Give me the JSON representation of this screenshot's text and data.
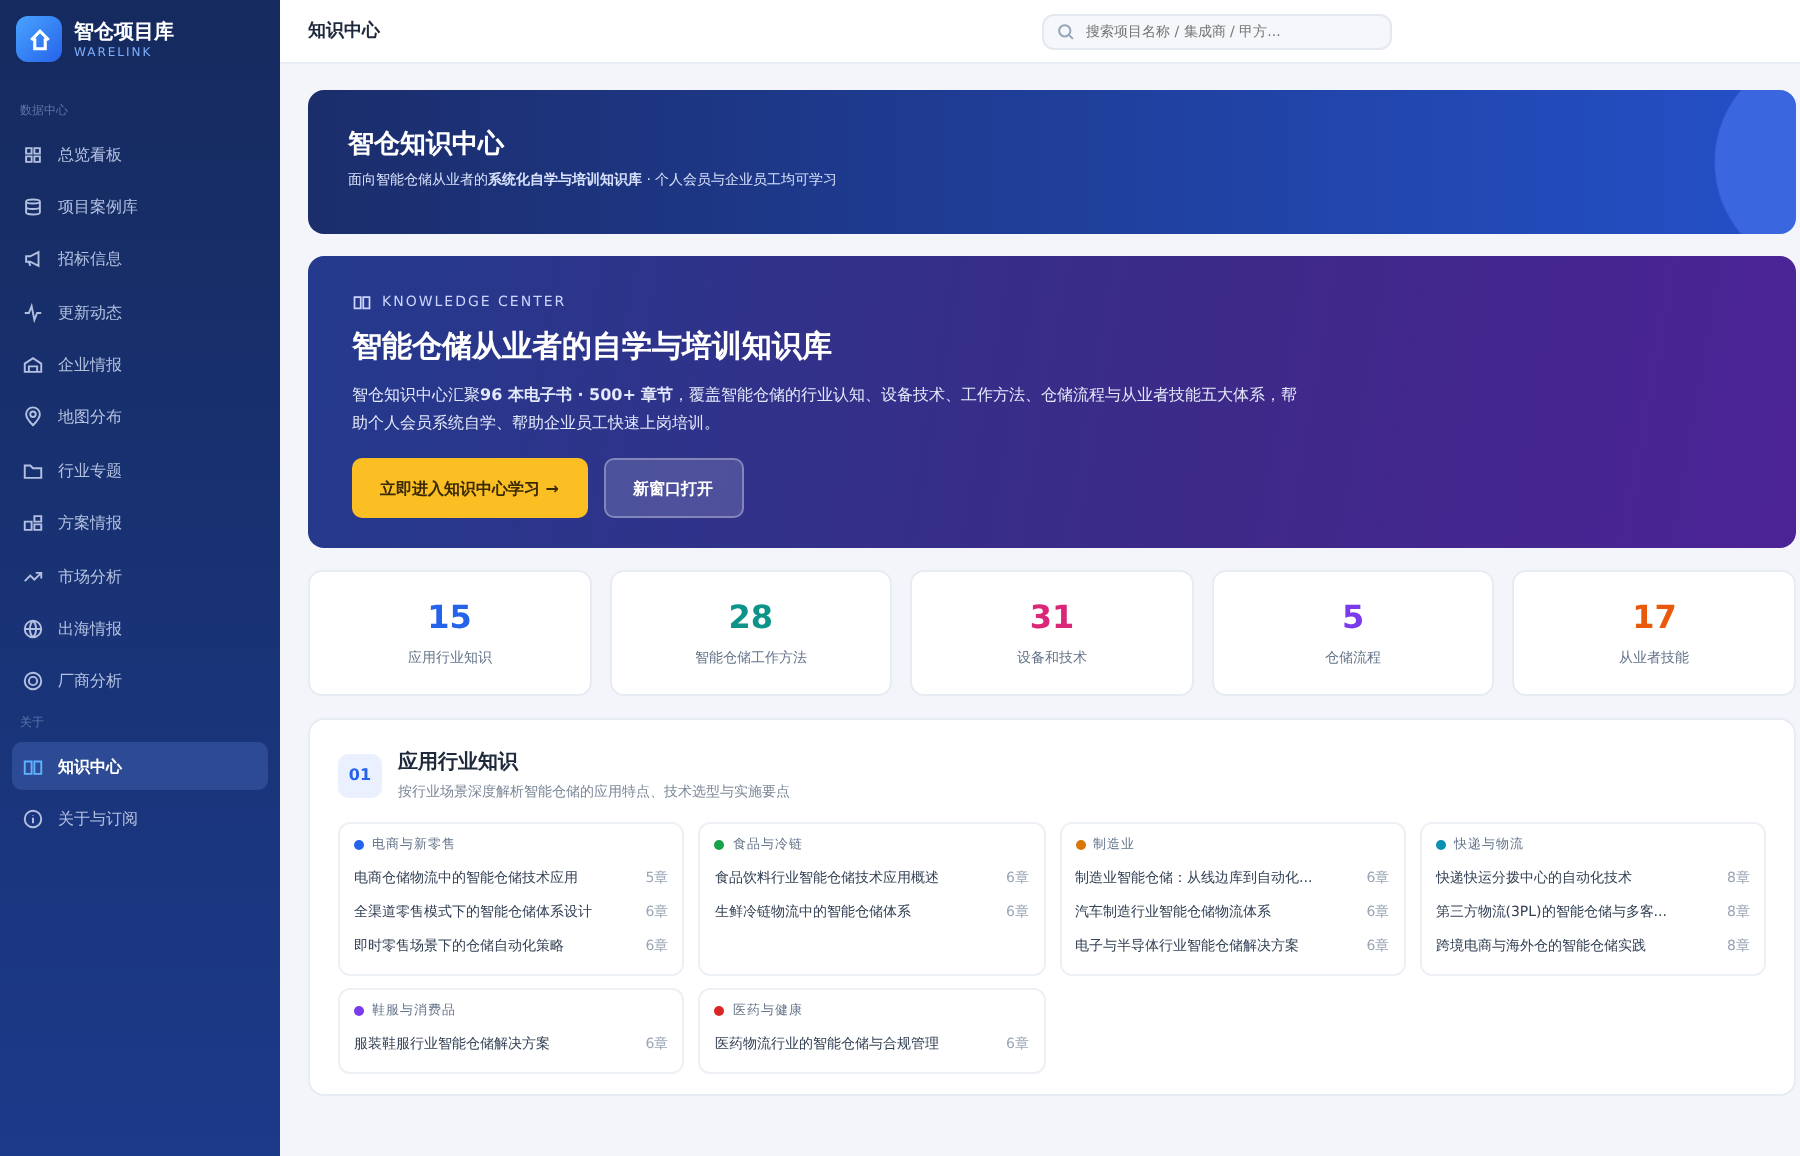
{
  "sidebar": {
    "logo": {
      "name": "智仓项目库",
      "subtitle": "WARELINK"
    },
    "groups": [
      {
        "title": "数据中心",
        "items": [
          {
            "label": "总览看板",
            "selected": false
          },
          {
            "label": "项目案例库",
            "selected": false
          },
          {
            "label": "招标信息",
            "selected": false
          },
          {
            "label": "更新动态",
            "selected": false
          },
          {
            "label": "企业情报",
            "selected": false
          },
          {
            "label": "地图分布",
            "selected": false
          },
          {
            "label": "行业专题",
            "selected": false
          },
          {
            "label": "方案情报",
            "selected": false
          },
          {
            "label": "市场分析",
            "selected": false
          },
          {
            "label": "出海情报",
            "selected": false
          },
          {
            "label": "厂商分析",
            "selected": false
          }
        ]
      },
      {
        "title": "关于",
        "items": [
          {
            "label": "知识中心",
            "selected": true
          },
          {
            "label": "关于与订阅",
            "selected": false
          }
        ]
      }
    ]
  },
  "topbar": {
    "title": "知识中心",
    "search": {
      "placeholder": "搜索项目名称 / 集成商 / 甲方..."
    }
  },
  "banner": {
    "title": "智仓知识中心",
    "subtitle": "面向智能仓储从业者的**系统化自学与培训知识库** · 个人会员与企业员工均可学习"
  },
  "hero": {
    "eyebrow": "KNOWLEDGE CENTER",
    "title": "智能仓储从业者的自学与培训知识库",
    "text": "智仓知识中心汇聚**96 本电子书 · 500+ 章节**，覆盖智能仓储的行业认知、设备技术、工作方法、仓储流程与从业者技能五大体系，帮助个人会员系统自学、帮助企业员工快速上岗培训。",
    "primary_button": "立即进入知识中心学习 →",
    "secondary_button": "新窗口打开"
  },
  "stats": [
    {
      "value": "15",
      "label": "应用行业知识",
      "color": "#2563eb"
    },
    {
      "value": "28",
      "label": "智能仓储工作方法",
      "color": "#0d9488"
    },
    {
      "value": "31",
      "label": "设备和技术",
      "color": "#db2777"
    },
    {
      "value": "5",
      "label": "仓储流程",
      "color": "#7c3aed"
    },
    {
      "value": "17",
      "label": "从业者技能",
      "color": "#ea580c"
    }
  ],
  "section": {
    "number": "01",
    "title": "应用行业知识",
    "subtitle": "按行业场景深度解析智能仓储的应用特点、技术选型与实施要点",
    "categories": [
      {
        "name": "电商与新零售",
        "color": "#2563eb",
        "books": [
          {
            "title": "电商仓储物流中的智能仓储技术应用",
            "chapters": "5章"
          },
          {
            "title": "全渠道零售模式下的智能仓储体系设计",
            "chapters": "6章"
          },
          {
            "title": "即时零售场景下的仓储自动化策略",
            "chapters": "6章"
          }
        ]
      },
      {
        "name": "食品与冷链",
        "color": "#16a34a",
        "books": [
          {
            "title": "食品饮料行业智能仓储技术应用概述",
            "chapters": "6章"
          },
          {
            "title": "生鲜冷链物流中的智能仓储体系",
            "chapters": "6章"
          }
        ]
      },
      {
        "name": "制造业",
        "color": "#d97706",
        "books": [
          {
            "title": "制造业智能仓储：从线边库到自动化...",
            "chapters": "6章"
          },
          {
            "title": "汽车制造行业智能仓储物流体系",
            "chapters": "6章"
          },
          {
            "title": "电子与半导体行业智能仓储解决方案",
            "chapters": "6章"
          }
        ]
      },
      {
        "name": "快递与物流",
        "color": "#0891b2",
        "books": [
          {
            "title": "快递快运分拨中心的自动化技术",
            "chapters": "8章"
          },
          {
            "title": "第三方物流(3PL)的智能仓储与多客...",
            "chapters": "8章"
          },
          {
            "title": "跨境电商与海外仓的智能仓储实践",
            "chapters": "8章"
          }
        ]
      },
      {
        "name": "鞋服与消费品",
        "color": "#7c3aed",
        "books": [
          {
            "title": "服装鞋服行业智能仓储解决方案",
            "chapters": "6章"
          }
        ]
      },
      {
        "name": "医药与健康",
        "color": "#dc2626",
        "books": [
          {
            "title": "医药物流行业的智能仓储与合规管理",
            "chapters": "6章"
          }
        ]
      }
    ]
  }
}
